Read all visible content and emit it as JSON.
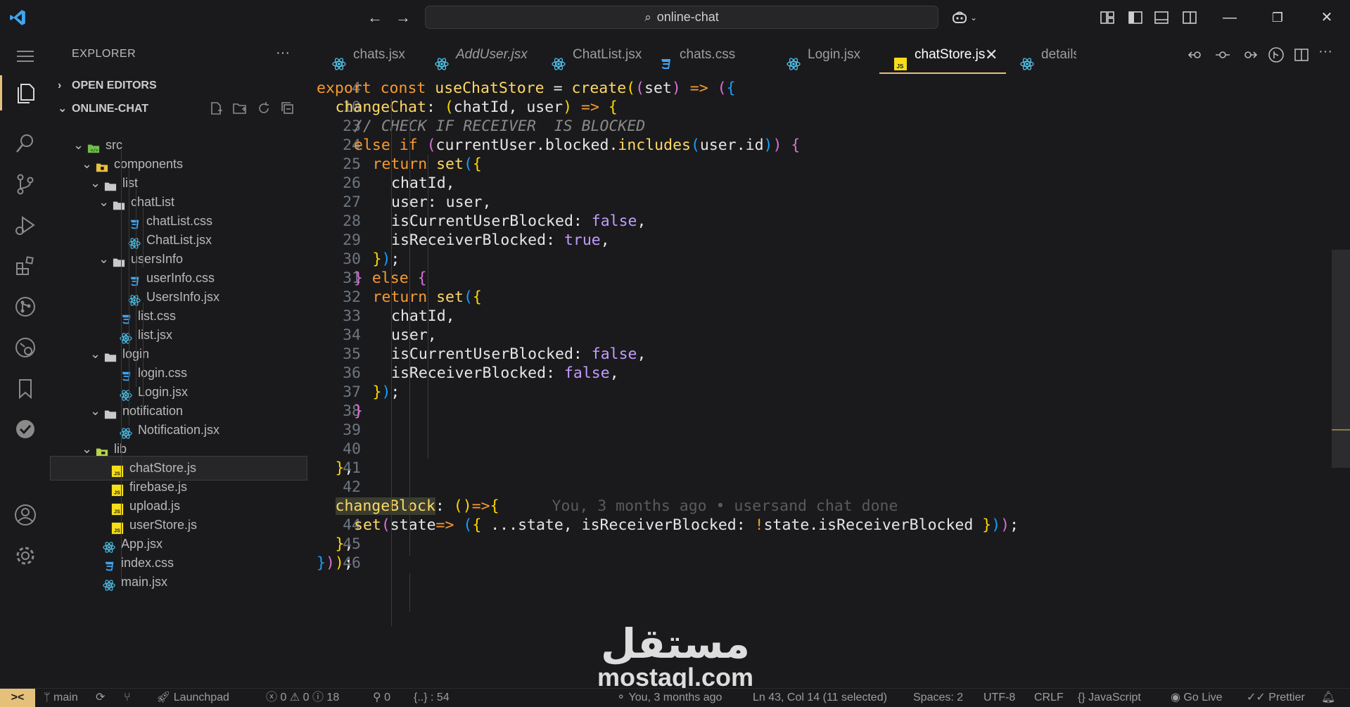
{
  "title_bar": {
    "search_text": "online-chat"
  },
  "explorer": {
    "header": "EXPLORER",
    "more": "···",
    "open_editors_label": "OPEN EDITORS",
    "project_label": "ONLINE-CHAT",
    "tree": [
      {
        "name": "src",
        "type": "folder-src",
        "depth": 1,
        "expanded": true
      },
      {
        "name": "components",
        "type": "folder-comp",
        "depth": 2,
        "expanded": true
      },
      {
        "name": "list",
        "type": "folder",
        "depth": 3,
        "expanded": true
      },
      {
        "name": "chatList",
        "type": "folder",
        "depth": 4,
        "expanded": true
      },
      {
        "name": "chatList.css",
        "type": "css",
        "depth": 5
      },
      {
        "name": "ChatList.jsx",
        "type": "react",
        "depth": 5
      },
      {
        "name": "usersInfo",
        "type": "folder",
        "depth": 4,
        "expanded": true
      },
      {
        "name": "userInfo.css",
        "type": "css",
        "depth": 5
      },
      {
        "name": "UsersInfo.jsx",
        "type": "react",
        "depth": 5
      },
      {
        "name": "list.css",
        "type": "css",
        "depth": 4
      },
      {
        "name": "list.jsx",
        "type": "react",
        "depth": 4
      },
      {
        "name": "login",
        "type": "folder",
        "depth": 3,
        "expanded": true
      },
      {
        "name": "login.css",
        "type": "css",
        "depth": 4
      },
      {
        "name": "Login.jsx",
        "type": "react",
        "depth": 4
      },
      {
        "name": "notification",
        "type": "folder",
        "depth": 3,
        "expanded": true
      },
      {
        "name": "Notification.jsx",
        "type": "react",
        "depth": 4
      },
      {
        "name": "lib",
        "type": "folder-lib",
        "depth": 2,
        "expanded": true
      },
      {
        "name": "chatStore.js",
        "type": "js",
        "depth": 3,
        "selected": true
      },
      {
        "name": "firebase.js",
        "type": "js",
        "depth": 3
      },
      {
        "name": "upload.js",
        "type": "js",
        "depth": 3
      },
      {
        "name": "userStore.js",
        "type": "js",
        "depth": 3
      },
      {
        "name": "App.jsx",
        "type": "react",
        "depth": 2
      },
      {
        "name": "index.css",
        "type": "css",
        "depth": 2
      },
      {
        "name": "main.jsx",
        "type": "react",
        "depth": 2
      }
    ]
  },
  "tabs": [
    {
      "label": "chats.jsx",
      "type": "react"
    },
    {
      "label": "AddUser.jsx",
      "type": "react",
      "italic": true
    },
    {
      "label": "ChatList.jsx",
      "type": "react"
    },
    {
      "label": "chats.css",
      "type": "css"
    },
    {
      "label": "Login.jsx",
      "type": "react"
    },
    {
      "label": "chatStore.js",
      "type": "js",
      "active": true
    },
    {
      "label": "details.jsx",
      "type": "react"
    }
  ],
  "tab_close": "✕",
  "editor": {
    "current_line": 43,
    "lines": [
      {
        "n": 4,
        "indent": 0,
        "tokens": [
          [
            "kw",
            "export "
          ],
          [
            "kw",
            "const "
          ],
          [
            "fn",
            "useChatStore"
          ],
          [
            "ph",
            " = "
          ],
          [
            "fn",
            "create"
          ],
          [
            "br1",
            "("
          ],
          [
            "br2",
            "("
          ],
          [
            "param",
            "set"
          ],
          [
            "br2",
            ")"
          ],
          [
            "kw",
            " => "
          ],
          [
            "br2",
            "("
          ],
          [
            "br3",
            "{"
          ]
        ]
      },
      {
        "n": 10,
        "indent": 1,
        "tokens": [
          [
            "fn",
            "changeChat"
          ],
          [
            "ph",
            ": "
          ],
          [
            "br1",
            "("
          ],
          [
            "param",
            "chatId, user"
          ],
          [
            "br1",
            ")"
          ],
          [
            "kw",
            " => "
          ],
          [
            "br1",
            "{"
          ]
        ]
      },
      {
        "n": 23,
        "indent": 2,
        "tokens": [
          [
            "cmt",
            "// CHECK IF RECEIVER  IS BLOCKED"
          ]
        ]
      },
      {
        "n": 24,
        "indent": 2,
        "tokens": [
          [
            "kw",
            "else if "
          ],
          [
            "br2",
            "("
          ],
          [
            "obj",
            "currentUser.blocked."
          ],
          [
            "fn",
            "includes"
          ],
          [
            "br3",
            "("
          ],
          [
            "obj",
            "user.id"
          ],
          [
            "br3",
            ")"
          ],
          [
            "br2",
            ")"
          ],
          [
            "ph",
            " "
          ],
          [
            "br2",
            "{"
          ]
        ]
      },
      {
        "n": 25,
        "indent": 3,
        "tokens": [
          [
            "kw",
            "return "
          ],
          [
            "fn",
            "set"
          ],
          [
            "br3",
            "("
          ],
          [
            "br1",
            "{"
          ]
        ]
      },
      {
        "n": 26,
        "indent": 4,
        "tokens": [
          [
            "prop",
            "chatId,"
          ]
        ]
      },
      {
        "n": 27,
        "indent": 4,
        "tokens": [
          [
            "prop",
            "user"
          ],
          [
            "ph",
            ": "
          ],
          [
            "obj",
            "user,"
          ]
        ]
      },
      {
        "n": 28,
        "indent": 4,
        "tokens": [
          [
            "prop",
            "isCurrentUserBlocked"
          ],
          [
            "ph",
            ": "
          ],
          [
            "bool",
            "false"
          ],
          [
            "ph",
            ","
          ]
        ]
      },
      {
        "n": 29,
        "indent": 4,
        "tokens": [
          [
            "prop",
            "isReceiverBlocked"
          ],
          [
            "ph",
            ": "
          ],
          [
            "bool",
            "true"
          ],
          [
            "ph",
            ","
          ]
        ]
      },
      {
        "n": 30,
        "indent": 3,
        "tokens": [
          [
            "br1",
            "}"
          ],
          [
            "br3",
            ")"
          ],
          [
            "ph",
            ";"
          ]
        ]
      },
      {
        "n": 31,
        "indent": 2,
        "tokens": [
          [
            "br2",
            "}"
          ],
          [
            "kw",
            " else "
          ],
          [
            "br2",
            "{"
          ]
        ]
      },
      {
        "n": 32,
        "indent": 3,
        "tokens": [
          [
            "kw",
            "return "
          ],
          [
            "fn",
            "set"
          ],
          [
            "br3",
            "("
          ],
          [
            "br1",
            "{"
          ]
        ]
      },
      {
        "n": 33,
        "indent": 4,
        "tokens": [
          [
            "prop",
            "chatId,"
          ]
        ]
      },
      {
        "n": 34,
        "indent": 4,
        "tokens": [
          [
            "prop",
            "user,"
          ]
        ]
      },
      {
        "n": 35,
        "indent": 4,
        "tokens": [
          [
            "prop",
            "isCurrentUserBlocked"
          ],
          [
            "ph",
            ": "
          ],
          [
            "bool",
            "false"
          ],
          [
            "ph",
            ","
          ]
        ]
      },
      {
        "n": 36,
        "indent": 4,
        "tokens": [
          [
            "prop",
            "isReceiverBlocked"
          ],
          [
            "ph",
            ": "
          ],
          [
            "bool",
            "false"
          ],
          [
            "ph",
            ","
          ]
        ]
      },
      {
        "n": 37,
        "indent": 3,
        "tokens": [
          [
            "br1",
            "}"
          ],
          [
            "br3",
            ")"
          ],
          [
            "ph",
            ";"
          ]
        ]
      },
      {
        "n": 38,
        "indent": 2,
        "tokens": [
          [
            "br2",
            "}"
          ]
        ]
      },
      {
        "n": 39,
        "indent": 0,
        "tokens": []
      },
      {
        "n": 40,
        "indent": 0,
        "tokens": []
      },
      {
        "n": 41,
        "indent": 1,
        "tokens": [
          [
            "br1",
            "}"
          ],
          [
            "ph",
            ","
          ]
        ]
      },
      {
        "n": 42,
        "indent": 0,
        "tokens": []
      },
      {
        "n": 43,
        "indent": 1,
        "tokens": [
          [
            "fn sel",
            "changeBlock"
          ],
          [
            "ph",
            ": "
          ],
          [
            "br1",
            "("
          ],
          [
            "br1",
            ")"
          ],
          [
            "kw",
            "=>"
          ],
          [
            "br1",
            "{"
          ]
        ],
        "blame": "You, 3 months ago • usersand chat done"
      },
      {
        "n": 44,
        "indent": 2,
        "tokens": [
          [
            "fn",
            "set"
          ],
          [
            "br2",
            "("
          ],
          [
            "param",
            "state"
          ],
          [
            "kw",
            "=> "
          ],
          [
            "br3",
            "("
          ],
          [
            "br1",
            "{ "
          ],
          [
            "ph",
            "..."
          ],
          [
            "obj",
            "state, isReceiverBlocked"
          ],
          [
            "ph",
            ": "
          ],
          [
            "kw",
            "!"
          ],
          [
            "obj",
            "state.isReceiverBlocked "
          ],
          [
            "br1",
            "}"
          ],
          [
            "br3",
            ")"
          ],
          [
            "br2",
            ")"
          ],
          [
            "ph",
            ";"
          ]
        ]
      },
      {
        "n": 45,
        "indent": 1,
        "tokens": [
          [
            "br1",
            "}"
          ],
          [
            "ph",
            ","
          ]
        ]
      },
      {
        "n": 46,
        "indent": 0,
        "tokens": [
          [
            "br3",
            "}"
          ],
          [
            "br2",
            ")"
          ],
          [
            "br1",
            ")"
          ],
          [
            "ph",
            ";"
          ]
        ]
      }
    ]
  },
  "watermark": {
    "arabic": "مستقل",
    "latin": "mostaql.com"
  },
  "status_bar": {
    "remote": "><",
    "branch": "main",
    "launchpad": "Launchpad",
    "errors": "0",
    "warnings": "0",
    "info": "18",
    "ports": "0",
    "braces": "{..} : 54",
    "blame": "You, 3 months ago",
    "cursor": "Ln 43, Col 14 (11 selected)",
    "spaces": "Spaces: 2",
    "encoding": "UTF-8",
    "eol": "CRLF",
    "language": "JavaScript",
    "golive": "Go Live",
    "prettier": "Prettier"
  },
  "colors": {
    "accent": "#e5c07b",
    "background": "#1a1a1c",
    "react": "#4fc1e9",
    "css": "#42a5f5",
    "js": "#f5de19",
    "folder": "#c9c9c9"
  }
}
